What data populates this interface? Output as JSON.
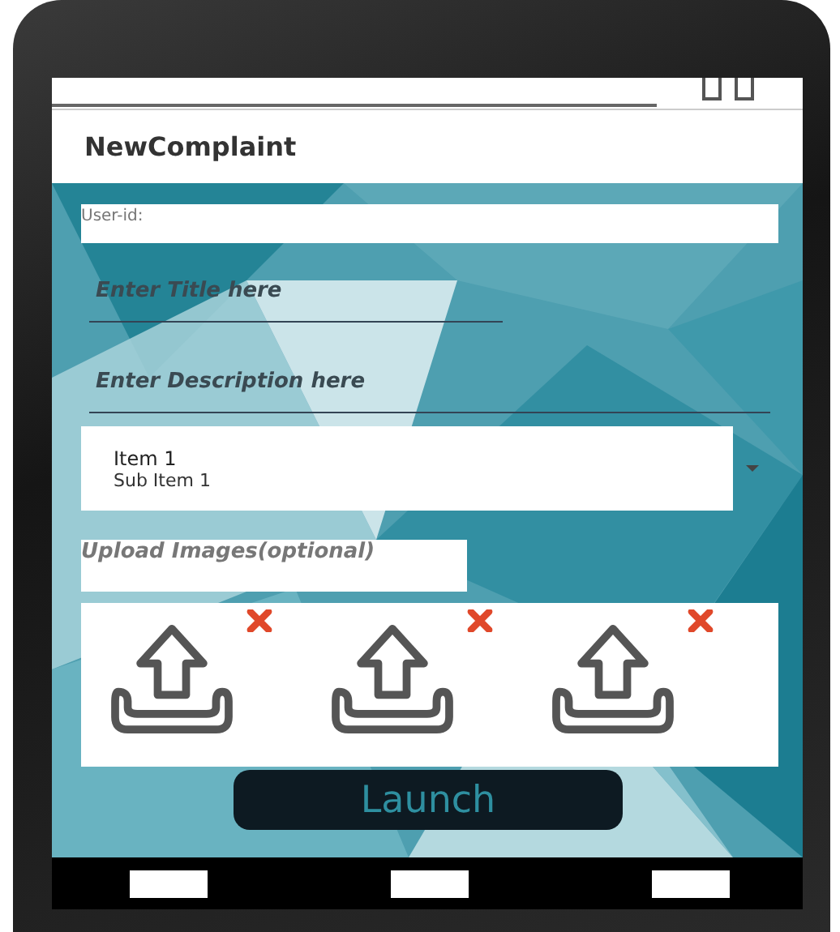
{
  "app_bar": {
    "title": "NewComplaint"
  },
  "form": {
    "user_id": {
      "placeholder": "User-id:"
    },
    "title_field": {
      "placeholder": "Enter Title here"
    },
    "description_field": {
      "placeholder": "Enter Description here"
    },
    "spinner": {
      "title": "Item 1",
      "subtitle": "Sub Item 1"
    },
    "upload_label": "Upload Images(optional)",
    "upload_slots": [
      {
        "removable": true
      },
      {
        "removable": true
      },
      {
        "removable": true
      }
    ]
  },
  "launch_button": "Launch"
}
